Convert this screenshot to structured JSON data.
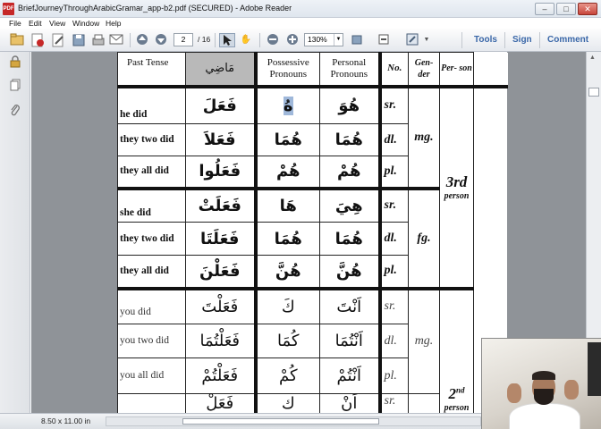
{
  "window": {
    "title": "BriefJourneyThroughArabicGramar_app-b2.pdf (SECURED) - Adobe Reader",
    "app_icon": "pdf-icon",
    "controls": [
      "minimize",
      "maximize",
      "close"
    ]
  },
  "menu": [
    "File",
    "Edit",
    "View",
    "Window",
    "Help"
  ],
  "toolbar": {
    "page_current": "2",
    "page_total": "/ 16",
    "zoom": "130%",
    "links": [
      "Tools",
      "Sign",
      "Comment"
    ]
  },
  "status": {
    "page_size": "8.50 x 11.00 in"
  },
  "table": {
    "headers": {
      "past_tense": "Past Tense",
      "past_tense_ar": "مَاضِي",
      "possessive": "Possessive Pronouns",
      "personal": "Personal Pronouns",
      "no": "No.",
      "gender": "Gen- der",
      "person": "Per- son"
    },
    "rows": [
      {
        "en": "he did",
        "verb": "فَعَلَ",
        "poss": "هُ",
        "pers": "هُوَ",
        "no": "sr."
      },
      {
        "en": "they two did",
        "verb": "فَعَلاَ",
        "poss": "هُمَا",
        "pers": "هُمَا",
        "no": "dl."
      },
      {
        "en": "they all did",
        "verb": "فَعَلُوا",
        "poss": "هُمْ",
        "pers": "هُمْ",
        "no": "pl."
      },
      {
        "en": "she did",
        "verb": "فَعَلَتْ",
        "poss": "هَا",
        "pers": "هِيَ",
        "no": "sr."
      },
      {
        "en": "they two did",
        "verb": "فَعَلَتَا",
        "poss": "هُمَا",
        "pers": "هُمَا",
        "no": "dl."
      },
      {
        "en": "they all did",
        "verb": "فَعَلْنَ",
        "poss": "هُنَّ",
        "pers": "هُنَّ",
        "no": "pl."
      },
      {
        "en": "you did",
        "verb": "فَعَلْتَ",
        "poss": "كَ",
        "pers": "اَنْتَ",
        "no": "sr."
      },
      {
        "en": "you two did",
        "verb": "فَعَلْتُمَا",
        "poss": "كُمَا",
        "pers": "اَنْتُمَا",
        "no": "dl."
      },
      {
        "en": "you all did",
        "verb": "فَعَلْتُمْ",
        "poss": "كُمْ",
        "pers": "اَنْتُمْ",
        "no": "pl."
      },
      {
        "en": "",
        "verb": "فَعَلْ",
        "poss": "ك",
        "pers": "اَنْ",
        "no": "sr."
      }
    ],
    "gender_mg": "mg.",
    "gender_fg": "fg.",
    "gender_mg2": "mg.",
    "person_3": "3rd",
    "person_3_sub": "person",
    "person_2": "2",
    "person_2_sup": "nd",
    "person_2_sub": "person"
  }
}
